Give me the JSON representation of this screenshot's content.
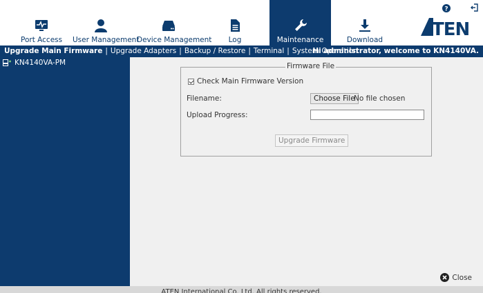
{
  "nav": {
    "items": [
      {
        "label": "Port Access",
        "icon": "monitor-pulse-icon",
        "active": false
      },
      {
        "label": "User Management",
        "icon": "user-icon",
        "active": false
      },
      {
        "label": "Device Management",
        "icon": "device-drive-icon",
        "active": false
      },
      {
        "label": "Log",
        "icon": "document-icon",
        "active": false
      },
      {
        "label": "Maintenance",
        "icon": "wrench-icon",
        "active": true
      },
      {
        "label": "Download",
        "icon": "download-icon",
        "active": false
      }
    ],
    "logo": "ATEN",
    "help_icon": "help-icon",
    "logout_icon": "logout-icon"
  },
  "submenu": {
    "items": [
      {
        "label": "Upgrade Main Firmware",
        "active": true
      },
      {
        "label": "Upgrade Adapters",
        "active": false
      },
      {
        "label": "Backup / Restore",
        "active": false
      },
      {
        "label": "Terminal",
        "active": false
      },
      {
        "label": "System Operation",
        "active": false
      }
    ],
    "separator": "|",
    "welcome": "Hi administrator, welcome to KN4140VA."
  },
  "sidebar": {
    "device": "KN4140VA-PM",
    "device_icon": "device-tree-icon"
  },
  "firmware": {
    "legend": "Firmware File",
    "check_label": "Check Main Firmware Version",
    "check_checked": true,
    "filename_label": "Filename:",
    "choose_file_label": "Choose File",
    "file_status": "No file chosen",
    "progress_label": "Upload Progress:",
    "progress_value": 0,
    "upgrade_button": "Upgrade Firmware"
  },
  "close_label": "Close",
  "footer": "ATEN International Co. Ltd. All rights reserved.",
  "colors": {
    "brand_navy": "#0d3b6e",
    "main_bg": "#f0f0f0"
  }
}
